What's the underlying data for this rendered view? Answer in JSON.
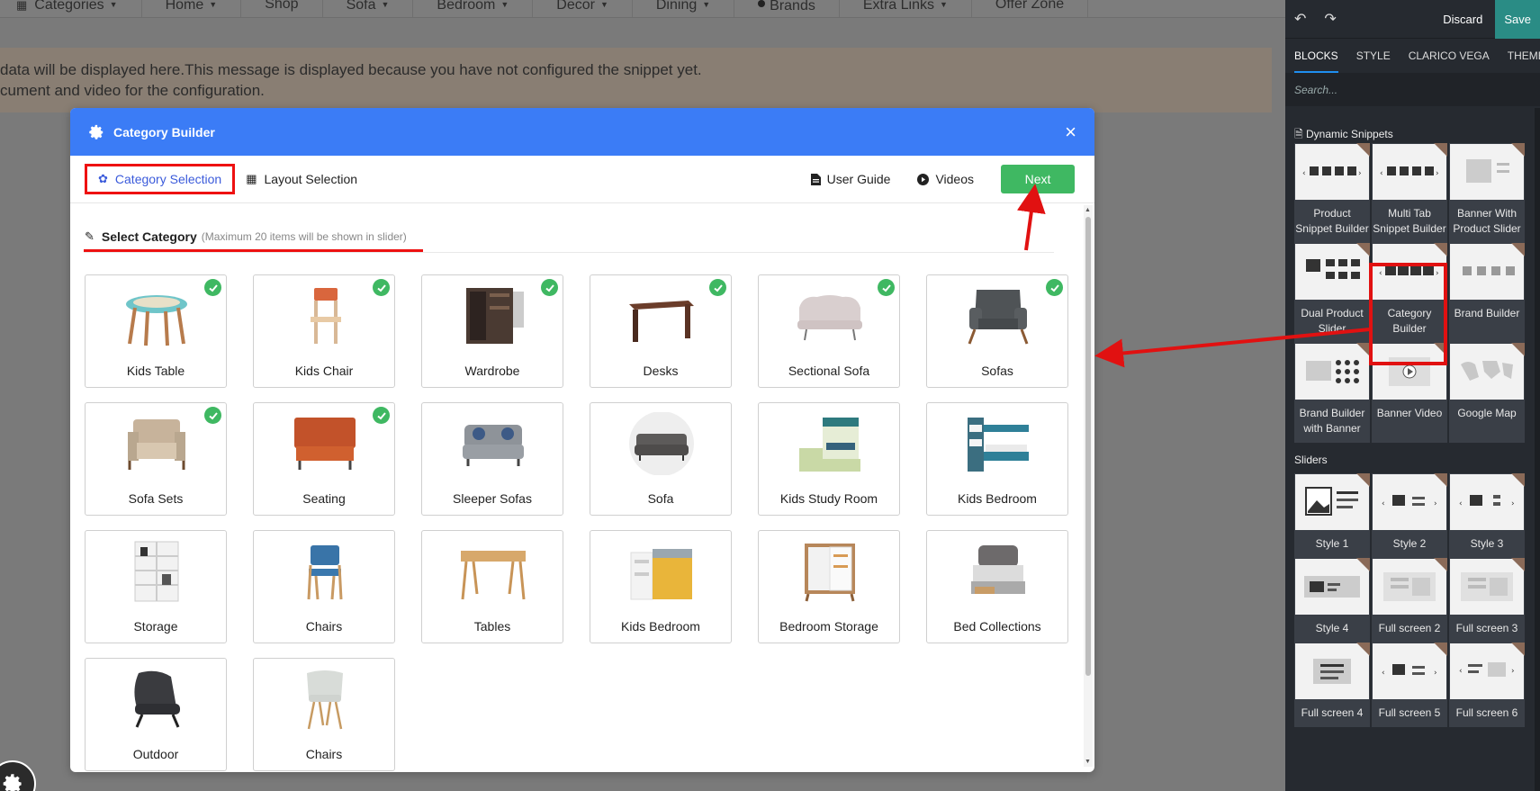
{
  "site_nav": {
    "items": [
      {
        "label": "Categories",
        "caret": true
      },
      {
        "label": "Home",
        "caret": true
      },
      {
        "label": "Shop",
        "caret": false
      },
      {
        "label": "Sofa",
        "caret": true
      },
      {
        "label": "Bedroom",
        "caret": true
      },
      {
        "label": "Decor",
        "caret": true
      },
      {
        "label": "Dining",
        "caret": true
      },
      {
        "label": "Brands",
        "caret": false
      },
      {
        "label": "Extra Links",
        "caret": true
      },
      {
        "label": "Offer Zone",
        "caret": false
      }
    ]
  },
  "notice": {
    "line1": "data will be displayed here.This message is displayed because you have not configured the snippet yet.",
    "line2": "cument and video for the configuration."
  },
  "modal": {
    "title": "Category Builder",
    "close_icon": "×",
    "tabs": [
      {
        "label": "Category Selection",
        "active": true
      },
      {
        "label": "Layout Selection",
        "active": false
      }
    ],
    "user_guide": "User Guide",
    "videos": "Videos",
    "next": "Next",
    "section_title": "Select Category",
    "section_hint": "(Maximum 20 items will be shown in slider)",
    "categories": [
      {
        "label": "Kids Table",
        "checked": true,
        "icon": "kids-table"
      },
      {
        "label": "Kids Chair",
        "checked": true,
        "icon": "kids-chair"
      },
      {
        "label": "Wardrobe",
        "checked": true,
        "icon": "wardrobe"
      },
      {
        "label": "Desks",
        "checked": true,
        "icon": "desk"
      },
      {
        "label": "Sectional Sofa",
        "checked": true,
        "icon": "sectional-sofa"
      },
      {
        "label": "Sofas",
        "checked": true,
        "icon": "armchair"
      },
      {
        "label": "Sofa Sets",
        "checked": true,
        "icon": "sofa-set"
      },
      {
        "label": "Seating",
        "checked": true,
        "icon": "seating"
      },
      {
        "label": "Sleeper Sofas",
        "checked": false,
        "icon": "sleeper-sofa"
      },
      {
        "label": "Sofa",
        "checked": false,
        "icon": "sofa"
      },
      {
        "label": "Kids Study Room",
        "checked": false,
        "icon": "kids-study"
      },
      {
        "label": "Kids Bedroom",
        "checked": false,
        "icon": "bunk-bed"
      },
      {
        "label": "Storage",
        "checked": false,
        "icon": "shelf"
      },
      {
        "label": "Chairs",
        "checked": false,
        "icon": "blue-chair"
      },
      {
        "label": "Tables",
        "checked": false,
        "icon": "table"
      },
      {
        "label": "Kids Bedroom",
        "checked": false,
        "icon": "loft-bed"
      },
      {
        "label": "Bedroom Storage",
        "checked": false,
        "icon": "cabinet"
      },
      {
        "label": "Bed Collections",
        "checked": false,
        "icon": "bed"
      },
      {
        "label": "Outdoor",
        "checked": false,
        "icon": "lounge-chair"
      },
      {
        "label": "Chairs",
        "checked": false,
        "icon": "shell-chair"
      }
    ]
  },
  "panel": {
    "discard": "Discard",
    "save": "Save",
    "tabs": [
      "BLOCKS",
      "STYLE",
      "CLARICO VEGA",
      "THEME"
    ],
    "search_placeholder": "Search...",
    "dynamic_heading": "Dynamic Snippets",
    "dynamic_snippets": [
      "Product Snippet Builder",
      "Multi Tab Snippet Builder",
      "Banner With Product Slider",
      "Dual Product Slider",
      "Category Builder",
      "Brand Builder",
      "Brand Builder with Banner",
      "Banner Video",
      "Google Map"
    ],
    "sliders_heading": "Sliders",
    "sliders": [
      "Style 1",
      "Style 2",
      "Style 3",
      "Style 4",
      "Full screen 2",
      "Full screen 3",
      "Full screen 4",
      "Full screen 5",
      "Full screen 6"
    ]
  },
  "colors": {
    "modal_header": "#3b7cf6",
    "next_button": "#3fb862",
    "annotation_red": "#e11111",
    "save_button": "#2a8c85"
  }
}
